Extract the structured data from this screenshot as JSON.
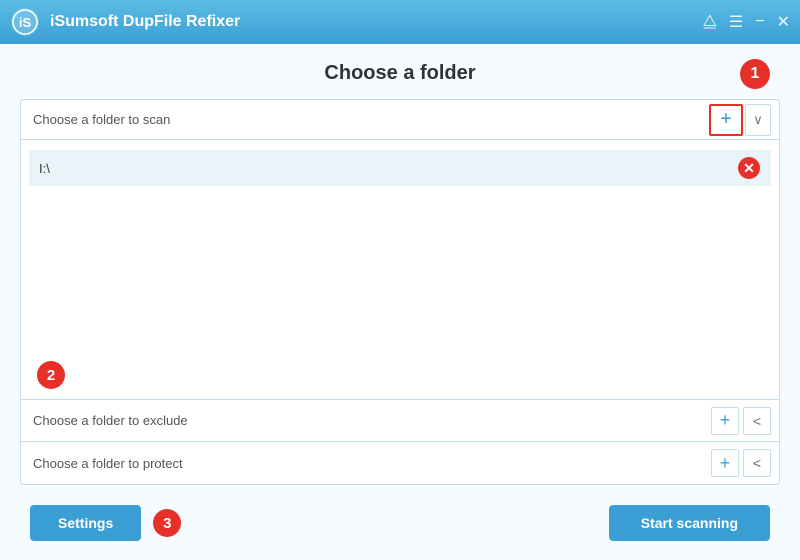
{
  "titleBar": {
    "title": "iSumsoft DupFile Refixer"
  },
  "page": {
    "title": "Choose a folder",
    "stepBadge1": "1",
    "stepBadge2": "2",
    "stepBadge3": "3"
  },
  "scanSection": {
    "label": "Choose a folder to scan",
    "addButton": "+",
    "chevronButton": "∨",
    "folders": [
      {
        "path": "I:\\"
      }
    ]
  },
  "excludeSection": {
    "label": "Choose a folder to exclude",
    "addButton": "+",
    "collapseButton": "<"
  },
  "protectSection": {
    "label": "Choose a folder to protect",
    "addButton": "+",
    "collapseButton": "<"
  },
  "toolbar": {
    "settingsLabel": "Settings",
    "startScanLabel": "Start scanning"
  }
}
